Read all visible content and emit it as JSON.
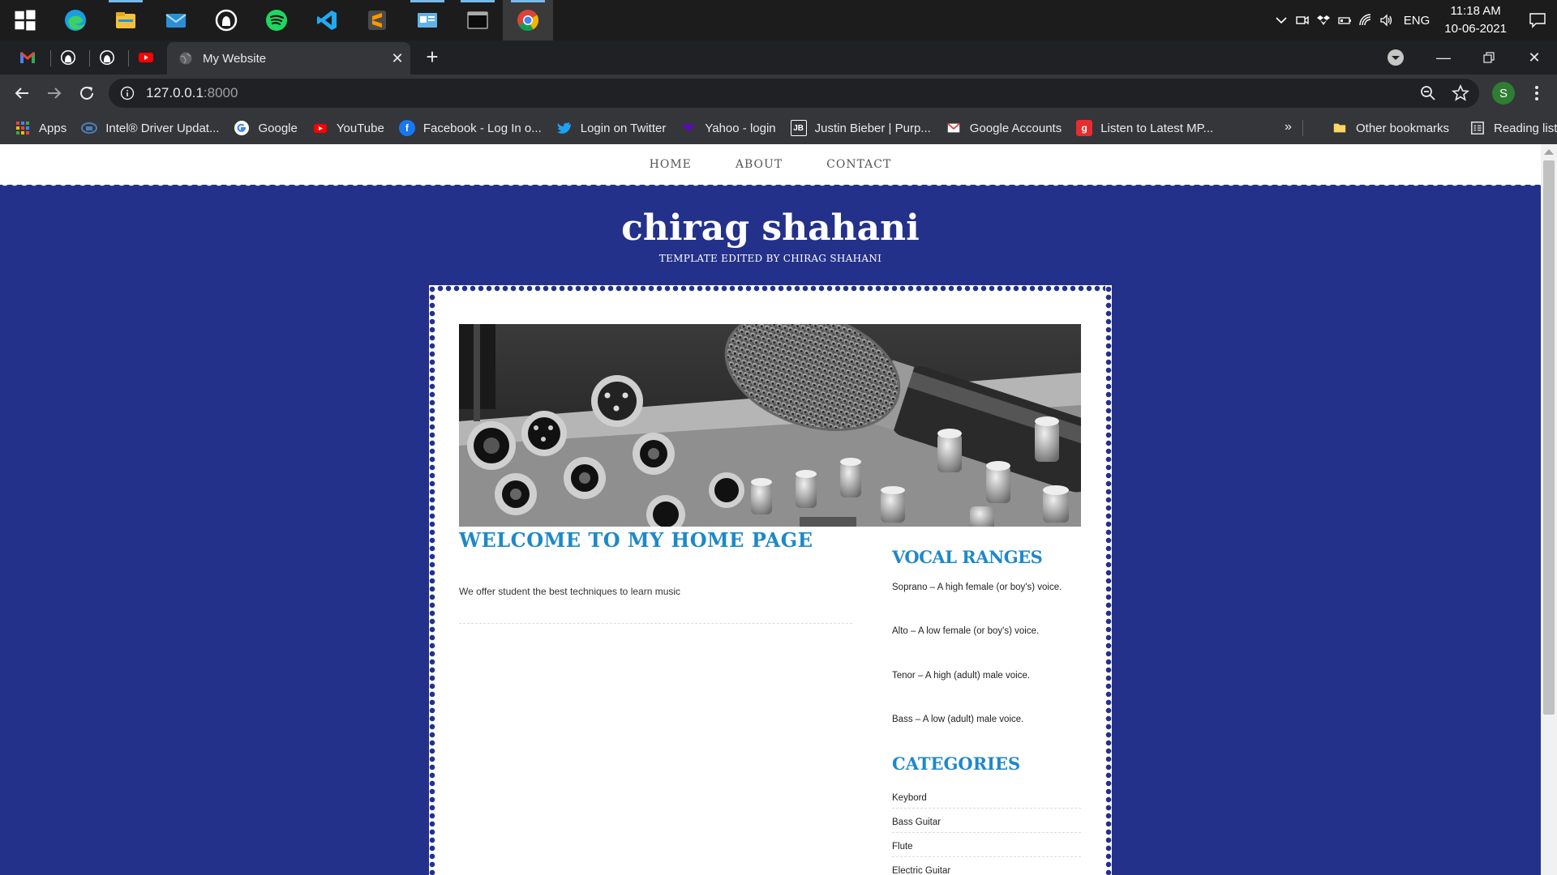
{
  "taskbar": {
    "apps": [
      {
        "name": "windows-start"
      },
      {
        "name": "edge"
      },
      {
        "name": "file-explorer"
      },
      {
        "name": "mail"
      },
      {
        "name": "github-desktop"
      },
      {
        "name": "spotify"
      },
      {
        "name": "vscode"
      },
      {
        "name": "sublime-text"
      },
      {
        "name": "control-panel"
      },
      {
        "name": "terminal"
      },
      {
        "name": "chrome"
      }
    ],
    "tray": {
      "language": "ENG",
      "time": "11:18 AM",
      "date": "10-06-2021"
    }
  },
  "browser": {
    "tab_title": "My Website",
    "url_host": "127.0.0.1",
    "url_port": ":8000",
    "profile_initial": "S",
    "bookmarks": [
      {
        "label": "Apps",
        "icon": "apps-grid-icon",
        "color": "#e8453c"
      },
      {
        "label": "Intel® Driver Updat...",
        "icon": "intel-icon",
        "color": "#4a7fb5"
      },
      {
        "label": "Google",
        "icon": "google-icon",
        "color": "#ffffff"
      },
      {
        "label": "YouTube",
        "icon": "youtube-icon",
        "color": "#ff0000"
      },
      {
        "label": "Facebook - Log In o...",
        "icon": "facebook-icon",
        "color": "#1877f2"
      },
      {
        "label": "Login on Twitter",
        "icon": "twitter-icon",
        "color": "#1da1f2"
      },
      {
        "label": "Yahoo - login",
        "icon": "yahoo-icon",
        "color": "#6001d2"
      },
      {
        "label": "Justin Bieber | Purp...",
        "icon": "jb-icon",
        "color": "#ffffff"
      },
      {
        "label": "Google Accounts",
        "icon": "gmail-icon",
        "color": "#ea4335"
      },
      {
        "label": "Listen to Latest MP...",
        "icon": "gaana-icon",
        "color": "#e72c30"
      }
    ],
    "more_label": "»",
    "other_bookmarks": "Other bookmarks",
    "reading_list": "Reading list"
  },
  "site": {
    "nav": [
      "HOME",
      "ABOUT",
      "CONTACT"
    ],
    "title": "chirag shahani",
    "tagline": "TEMPLATE EDITED BY CHIRAG SHAHANI",
    "welcome_heading": "WELCOME TO MY HOME PAGE",
    "welcome_text": "We offer student the best techniques to learn music",
    "vocal_heading": "VOCAL RANGES",
    "vocal_ranges": [
      "Soprano – A high female (or boy's) voice.",
      "Alto – A low female (or boy's) voice.",
      "Tenor – A high (adult) male voice.",
      "Bass – A low (adult) male voice."
    ],
    "categories_heading": "CATEGORIES",
    "categories": [
      "Keybord",
      "Bass Guitar",
      "Flute",
      "Electric Guitar"
    ]
  },
  "colors": {
    "page_bg": "#24318a",
    "accent": "#1e88c9",
    "chrome_dark": "#202124",
    "chrome_toolbar": "#35363a"
  }
}
